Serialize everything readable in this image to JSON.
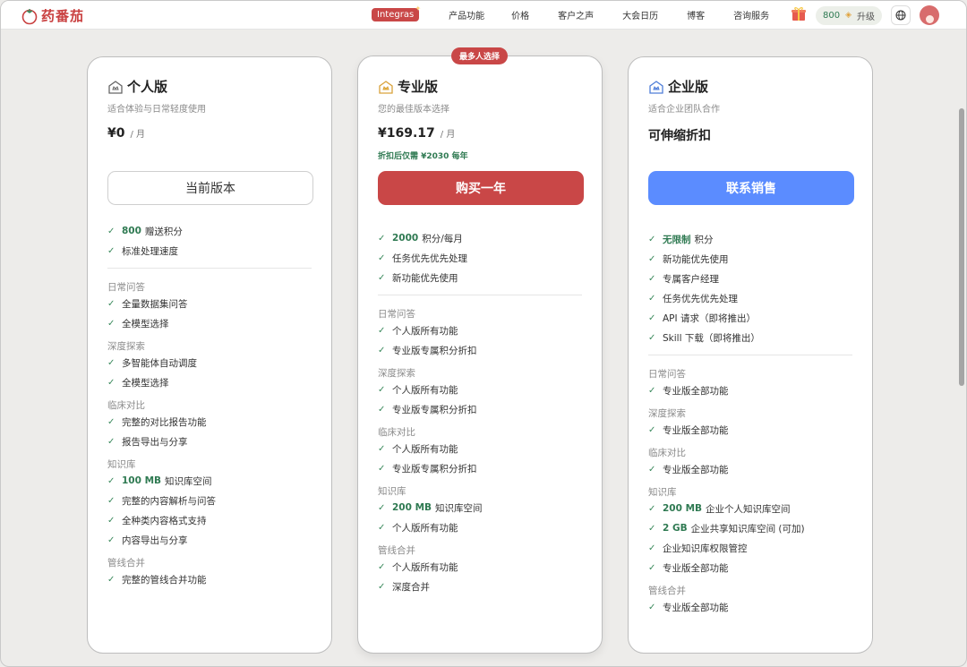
{
  "header": {
    "logo_text": "药番茄",
    "nav": [
      "Integras",
      "产品功能",
      "价格",
      "客户之声",
      "大会日历",
      "博客",
      "咨询服务"
    ],
    "points": "800",
    "upgrade_label": "升级"
  },
  "plans": [
    {
      "name": "个人版",
      "subtitle": "适合体验与日常轻度使用",
      "price": "¥0",
      "per": "/ 月",
      "note": "",
      "cta": "当前版本",
      "top_features": [
        {
          "hl": "800",
          "text": "赠送积分"
        },
        {
          "hl": "",
          "text": "标准处理速度"
        }
      ],
      "sections": [
        {
          "title": "日常问答",
          "items": [
            {
              "hl": "",
              "text": "全量数据集问答"
            },
            {
              "hl": "",
              "text": "全模型选择"
            }
          ]
        },
        {
          "title": "深度探索",
          "items": [
            {
              "hl": "",
              "text": "多智能体自动调度"
            },
            {
              "hl": "",
              "text": "全模型选择"
            }
          ]
        },
        {
          "title": "临床对比",
          "items": [
            {
              "hl": "",
              "text": "完整的对比报告功能"
            },
            {
              "hl": "",
              "text": "报告导出与分享"
            }
          ]
        },
        {
          "title": "知识库",
          "items": [
            {
              "hl": "100 MB",
              "text": "知识库空间"
            },
            {
              "hl": "",
              "text": "完整的内容解析与问答"
            },
            {
              "hl": "",
              "text": "全种类内容格式支持"
            },
            {
              "hl": "",
              "text": "内容导出与分享"
            }
          ]
        },
        {
          "title": "管线合并",
          "items": [
            {
              "hl": "",
              "text": "完整的管线合并功能"
            }
          ]
        }
      ]
    },
    {
      "name": "专业版",
      "badge": "最多人选择",
      "subtitle": "您的最佳版本选择",
      "price": "¥169.17",
      "per": "/ 月",
      "note": "折扣后仅需 ¥2030 每年",
      "cta": "购买一年",
      "top_features": [
        {
          "hl": "2000",
          "text": "积分/每月"
        },
        {
          "hl": "",
          "text": "任务优先优先处理"
        },
        {
          "hl": "",
          "text": "新功能优先使用"
        }
      ],
      "sections": [
        {
          "title": "日常问答",
          "items": [
            {
              "hl": "",
              "text": "个人版所有功能"
            },
            {
              "hl": "",
              "text": "专业版专属积分折扣"
            }
          ]
        },
        {
          "title": "深度探索",
          "items": [
            {
              "hl": "",
              "text": "个人版所有功能"
            },
            {
              "hl": "",
              "text": "专业版专属积分折扣"
            }
          ]
        },
        {
          "title": "临床对比",
          "items": [
            {
              "hl": "",
              "text": "个人版所有功能"
            },
            {
              "hl": "",
              "text": "专业版专属积分折扣"
            }
          ]
        },
        {
          "title": "知识库",
          "items": [
            {
              "hl": "200 MB",
              "text": "知识库空间"
            },
            {
              "hl": "",
              "text": "个人版所有功能"
            }
          ]
        },
        {
          "title": "管线合并",
          "items": [
            {
              "hl": "",
              "text": "个人版所有功能"
            },
            {
              "hl": "",
              "text": "深度合并"
            }
          ]
        }
      ]
    },
    {
      "name": "企业版",
      "subtitle": "适合企业团队合作",
      "price": "可伸缩折扣",
      "per": "",
      "note": "",
      "cta": "联系销售",
      "top_features": [
        {
          "hl": "无限制",
          "text": "积分"
        },
        {
          "hl": "",
          "text": "新功能优先使用"
        },
        {
          "hl": "",
          "text": "专属客户经理"
        },
        {
          "hl": "",
          "text": "任务优先优先处理"
        },
        {
          "hl": "",
          "text": "API 请求（即将推出）"
        },
        {
          "hl": "",
          "text": "Skill 下载（即将推出）"
        }
      ],
      "sections": [
        {
          "title": "日常问答",
          "items": [
            {
              "hl": "",
              "text": "专业版全部功能"
            }
          ]
        },
        {
          "title": "深度探索",
          "items": [
            {
              "hl": "",
              "text": "专业版全部功能"
            }
          ]
        },
        {
          "title": "临床对比",
          "items": [
            {
              "hl": "",
              "text": "专业版全部功能"
            }
          ]
        },
        {
          "title": "知识库",
          "items": [
            {
              "hl": "200 MB",
              "text": "企业个人知识库空间"
            },
            {
              "hl": "2 GB",
              "text": "企业共享知识库空间 (可加)"
            },
            {
              "hl": "",
              "text": "企业知识库权限管控"
            },
            {
              "hl": "",
              "text": "专业版全部功能"
            }
          ]
        },
        {
          "title": "管线合并",
          "items": [
            {
              "hl": "",
              "text": "专业版全部功能"
            }
          ]
        }
      ]
    }
  ],
  "colors": {
    "brand_red": "#c94747",
    "green": "#2f7a52",
    "blue": "#5b8cff"
  }
}
